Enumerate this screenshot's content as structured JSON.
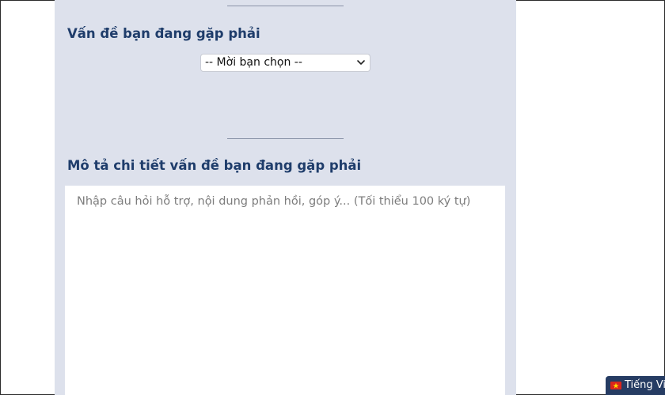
{
  "form": {
    "issue_section": {
      "title": "Vấn đề bạn đang gặp phải",
      "select": {
        "selected": "-- Mời bạn chọn --"
      }
    },
    "description_section": {
      "title": "Mô tả chi tiết vấn đề bạn đang gặp phải",
      "textarea": {
        "value": "",
        "placeholder": "Nhập câu hỏi hỗ trợ, nội dung phản hồi, góp ý... (Tối thiểu 100 ký tự)"
      }
    }
  },
  "language_switcher": {
    "label": "Tiếng Việt",
    "flag_icon": "vietnam-flag-icon"
  },
  "colors": {
    "panel_background": "#dde1ec",
    "title_color": "#1f3d6b",
    "language_button": "#263c63",
    "flag_red": "#da251d",
    "flag_star": "#ffde00"
  }
}
